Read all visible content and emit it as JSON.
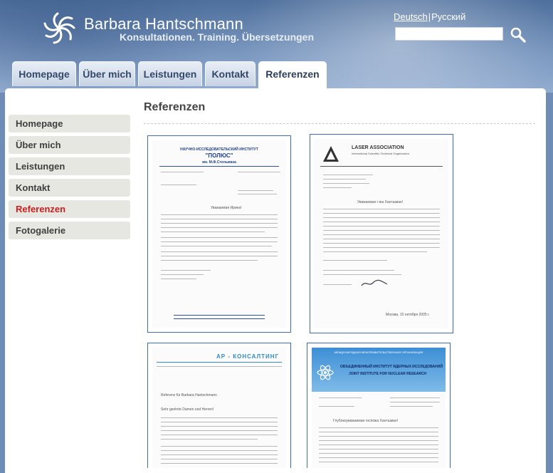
{
  "header": {
    "site_name": "Barbara Hantschmann",
    "tagline": "Konsultationen. Training. Übersetzungen",
    "lang_de": "Deutsch",
    "lang_sep": "|",
    "lang_ru": "Русский",
    "search_placeholder": ""
  },
  "tabs": [
    "Homepage",
    "Über mich",
    "Leistungen",
    "Kontakt",
    "Referenzen"
  ],
  "sidebar": [
    "Homepage",
    "Über mich",
    "Leistungen",
    "Kontakt",
    "Referenzen",
    "Fotogalerie"
  ],
  "content": {
    "title": "Referenzen",
    "doc1": {
      "institute": "НАУЧНО-ИССЛЕДОВАТЕЛЬСКИЙ ИНСТИТУТ",
      "name": "\"ПОЛЮС\"",
      "sub": "им. М.Ф.Стельмаха",
      "salutation": "Уважаемая Ирина!"
    },
    "doc2": {
      "org": "LASER ASSOCIATION",
      "org_sub": "International Scientific-Technical Organization",
      "greeting": "Уважаемая г-жа Хантшман!",
      "date": "Москва, 10 октября 2005 г."
    },
    "doc3": {
      "company": "АР - КОНСАЛТИНГ",
      "heading": "Referenz für Barbara Hantschmann",
      "salutation": "Sehr geehrte Damen und Herren!"
    },
    "doc4": {
      "line1": "МЕЖДУНАРОДНАЯ МЕЖПРАВИТЕЛЬСТВЕННАЯ ОРГАНИЗАЦИЯ",
      "line2": "ОБЪЕДИНЕННЫЙ ИНСТИТУТ ЯДЕРНЫХ ИССЛЕДОВАНИЙ",
      "line3": "JOINT INSTITUTE FOR NUCLEAR RESEARCH",
      "greeting": "Глубокоуважаемая госпожа Хантшман!"
    }
  },
  "colors": {
    "accent_red": "#cc1d1d",
    "frame_blue": "#3d6bb7",
    "tab_text": "#34496a"
  }
}
